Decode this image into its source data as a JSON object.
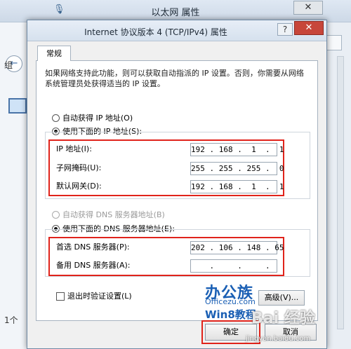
{
  "bg_window": {
    "title": "以太网 属性",
    "close_glyph": "✕",
    "left_item_1": "组",
    "left_item_2": "1个",
    "mic_glyph": "🎙"
  },
  "dialog": {
    "title": "Internet 协议版本 4 (TCP/IPv4) 属性",
    "help_glyph": "?",
    "close_glyph": "✕",
    "tab_label": "常规",
    "description": "如果网络支持此功能，则可以获取自动指派的 IP 设置。否则，你需要从网络系统管理员处获得适当的 IP 设置。",
    "ip_section": {
      "auto_label": "自动获得 IP 地址(O)",
      "manual_label": "使用下面的 IP 地址(S):",
      "selected": "manual",
      "fields": [
        {
          "label": "IP 地址(I):",
          "value": "192 . 168 .  1  .  1"
        },
        {
          "label": "子网掩码(U):",
          "value": "255 . 255 . 255 .  0"
        },
        {
          "label": "默认网关(D):",
          "value": "192 . 168 .  1  .  1"
        }
      ]
    },
    "dns_section": {
      "auto_label": "自动获得 DNS 服务器地址(B)",
      "manual_label": "使用下面的 DNS 服务器地址(E):",
      "selected": "manual",
      "fields": [
        {
          "label": "首选 DNS 服务器(P):",
          "value": "202 . 106 . 148 . 65"
        },
        {
          "label": "备用 DNS 服务器(A):",
          "value": "    .     .     .    "
        }
      ]
    },
    "validate_label": "退出时验证设置(L)",
    "validate_checked": false,
    "advanced_label": "高级(V)...",
    "ok_label": "确定",
    "cancel_label": "取消"
  },
  "watermark": {
    "brand_cn": "办公族",
    "brand_url": "Officezu.com",
    "brand_sub": "Win8教程",
    "baidu": "Bai 经验",
    "baidu_url": "jingyan.baidu.com"
  },
  "colors": {
    "highlight": "#e0231b",
    "dialog_bg": "#f0f0f0",
    "titlebar": "#dbe5f0",
    "close_red": "#c7463a"
  }
}
